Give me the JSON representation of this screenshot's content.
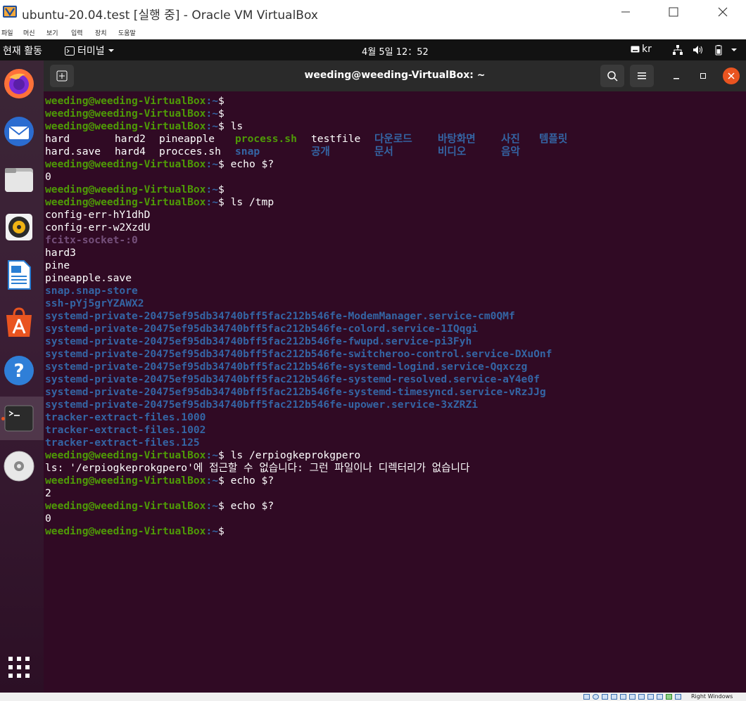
{
  "window": {
    "title": "ubuntu-20.04.test [실행 중] - Oracle VM VirtualBox"
  },
  "menu": [
    "파일",
    "머신",
    "보기",
    "입력",
    "장치",
    "도움말"
  ],
  "topbar": {
    "activities": "현재 활동",
    "app_name": "터미널",
    "clock": "4월 5일  12：52",
    "keyboard": "kr"
  },
  "dock": {
    "items": [
      "firefox-icon",
      "thunderbird-icon",
      "files-icon",
      "rhythmbox-icon",
      "libreoffice-writer-icon",
      "software-icon",
      "help-icon",
      "terminal-icon",
      "dvd-icon",
      "show-apps-icon"
    ]
  },
  "terminal": {
    "title": "weeding@weeding-VirtualBox: ~",
    "prompt_user": "weeding@weeding-VirtualBox",
    "prompt_path": ":~",
    "prompt_sign": "$",
    "cmd": {
      "ls": " ls",
      "echo1": " echo $?",
      "ls_tmp": " ls /tmp",
      "ls_bad": " ls /erpiogkeprokgpero",
      "echo2": " echo $?",
      "echo3": " echo $?"
    },
    "ls_row1": [
      "hard",
      "hard2",
      "pineapple",
      "process.sh",
      "testfile",
      "다운로드",
      "바탕화면",
      "사진",
      "템플릿"
    ],
    "ls_row2": [
      "hard.save",
      "hard4",
      "procces.sh",
      "snap",
      "공개",
      "문서",
      "비디오",
      "음악"
    ],
    "out_echo1": "0",
    "tmp": [
      "config-err-hY1dhD",
      "config-err-w2XzdU",
      "fcitx-socket-:0",
      "hard3",
      "pine",
      "pineapple.save",
      "snap.snap-store",
      "ssh-pYj5grYZAWX2",
      "systemd-private-20475ef95db34740bff5fac212b546fe-ModemManager.service-cm0QMf",
      "systemd-private-20475ef95db34740bff5fac212b546fe-colord.service-1IQqgi",
      "systemd-private-20475ef95db34740bff5fac212b546fe-fwupd.service-pi3Fyh",
      "systemd-private-20475ef95db34740bff5fac212b546fe-switcheroo-control.service-DXuOnf",
      "systemd-private-20475ef95db34740bff5fac212b546fe-systemd-logind.service-Qqxczg",
      "systemd-private-20475ef95db34740bff5fac212b546fe-systemd-resolved.service-aY4e0f",
      "systemd-private-20475ef95db34740bff5fac212b546fe-systemd-timesyncd.service-vRzJJg",
      "systemd-private-20475ef95db34740bff5fac212b546fe-upower.service-3xZRZi",
      "tracker-extract-files.1000",
      "tracker-extract-files.1002",
      "tracker-extract-files.125"
    ],
    "err_line": "ls: '/erpiogkeprokgpero'에 접근할 수 없습니다: 그런 파일이나 디렉터리가 없습니다",
    "out_echo2": "2",
    "out_echo3": "0"
  },
  "statusbar": {
    "right_label": "Right Windows"
  }
}
